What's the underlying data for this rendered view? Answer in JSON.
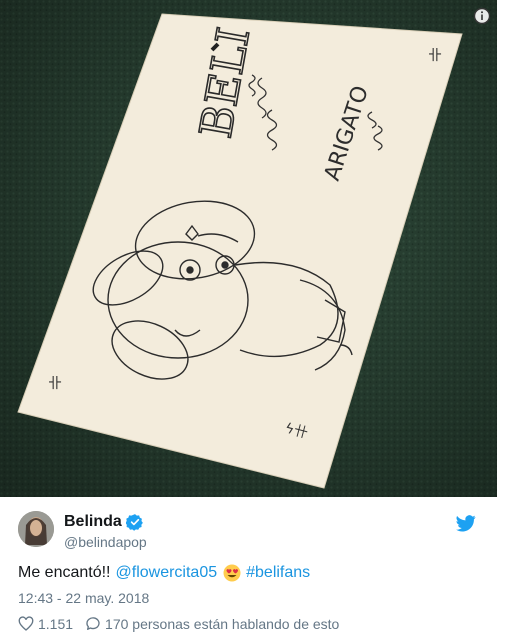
{
  "tweet": {
    "author_name": "Belinda",
    "author_handle": "@belindapop",
    "text_prefix": "Me encantó!!",
    "mention": "@flowercita05",
    "hashtag": "#belifans",
    "timestamp": "12:43 - 22 may. 2018",
    "like_count": "1.151",
    "conversation_text": "170 personas están hablando de esto"
  },
  "drawing": {
    "name_text": "BELI",
    "arigato_text": "ARIGATO"
  },
  "colors": {
    "link": "#1b95e0",
    "verified": "#1da1f2",
    "secondary_text": "#657786",
    "carpet": "#2f4a3a",
    "paper": "#f3ecdc"
  },
  "icons": {
    "info": "info-icon",
    "verified": "verified-badge-icon",
    "twitter": "twitter-bird-icon",
    "emoji": "heart-eyes-emoji-icon",
    "like": "heart-icon",
    "reply": "speech-bubble-icon"
  }
}
